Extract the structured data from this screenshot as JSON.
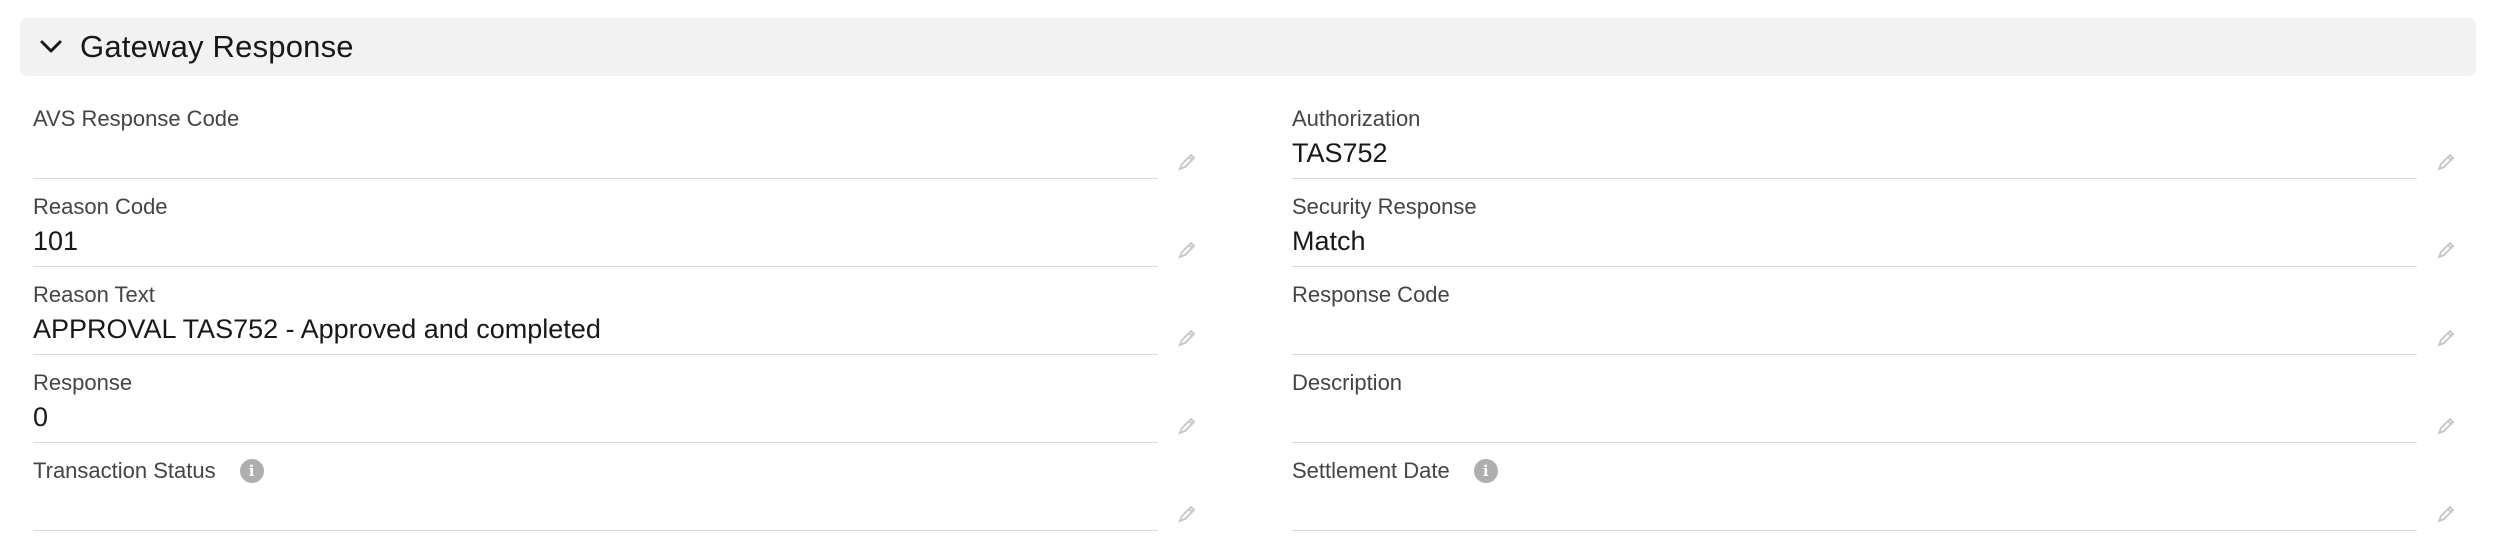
{
  "section": {
    "title": "Gateway Response",
    "icon": "chevron-down-icon"
  },
  "left_fields": [
    {
      "label": "AVS Response Code",
      "value": "",
      "has_info": false
    },
    {
      "label": "Reason Code",
      "value": "101",
      "has_info": false
    },
    {
      "label": "Reason Text",
      "value": "APPROVAL TAS752 - Approved and completed",
      "has_info": false
    },
    {
      "label": "Response",
      "value": "0",
      "has_info": false
    },
    {
      "label": "Transaction Status",
      "value": "",
      "has_info": true
    }
  ],
  "right_fields": [
    {
      "label": "Authorization",
      "value": "TAS752",
      "has_info": false
    },
    {
      "label": "Security Response",
      "value": "Match",
      "has_info": false
    },
    {
      "label": "Response Code",
      "value": "",
      "has_info": false
    },
    {
      "label": "Description",
      "value": "",
      "has_info": false
    },
    {
      "label": "Settlement Date",
      "value": "",
      "has_info": true
    }
  ],
  "icons": {
    "info": "info-icon",
    "edit": "pencil-edit-icon"
  },
  "colors": {
    "header_bg": "#f3f2f2",
    "label": "#444444",
    "value": "#181818",
    "divider": "#dddbda",
    "icon_gray": "#aeaeae"
  }
}
